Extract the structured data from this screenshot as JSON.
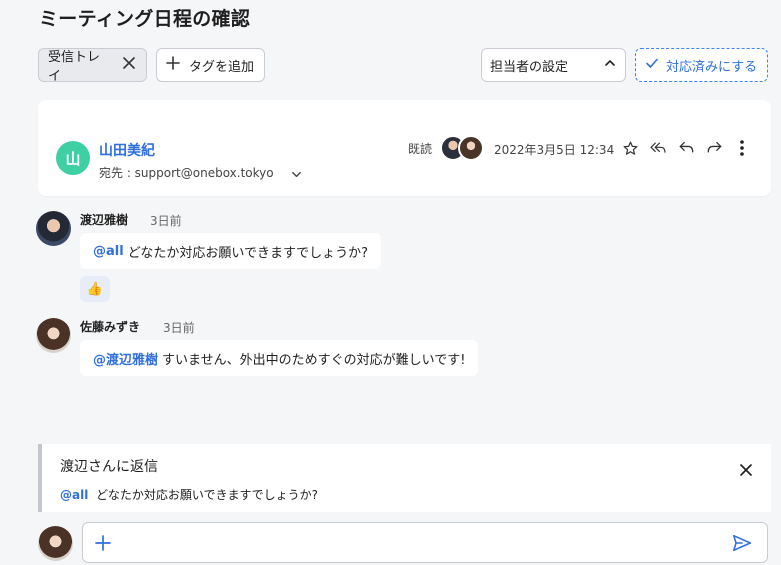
{
  "header": {
    "title": "ミーティング日程の確認"
  },
  "toolbar": {
    "inbox_tag": "受信トレイ",
    "add_tag": "タグを追加",
    "assignee": "担当者の設定",
    "mark_done": "対応済みにする"
  },
  "mail": {
    "sender_initial": "山",
    "sender_name": "山田美紀",
    "recipient": "宛先 : support@onebox.tokyo",
    "read_label": "既読",
    "date": "2022年3月5日 12:34",
    "colors": {
      "avatar": "#3ecfa3",
      "accent": "#2f6fde"
    }
  },
  "comments": [
    {
      "author": "渡辺雅樹",
      "time": "3日前",
      "mention": "@all",
      "text": "どなたか対応お願いできますでしょうか?",
      "reaction": "👍"
    },
    {
      "author": "佐藤みずき",
      "time": "3日前",
      "mention": "@渡辺雅樹",
      "text": "すいません、外出中のためすぐの対応が難しいです!"
    }
  ],
  "reply": {
    "title": "渡辺さんに返信",
    "quote_mention": "@all",
    "quote_text": "どなたか対応お願いできますでしょうか?"
  },
  "icons": {
    "star": "star-icon",
    "reply_all": "reply-all-icon",
    "reply": "reply-icon",
    "forward": "forward-icon",
    "more": "more-vertical-icon",
    "send": "send-icon"
  }
}
